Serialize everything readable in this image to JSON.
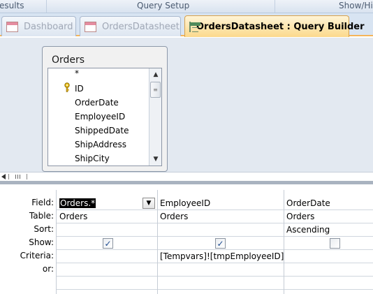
{
  "ribbon": {
    "groups": [
      "esults",
      "Query Setup",
      "Show/Hi"
    ]
  },
  "tabs": [
    {
      "label": "Dashboard",
      "icon": "form-icon",
      "active": false
    },
    {
      "label": "OrdersDatasheet",
      "icon": "form-icon",
      "active": false
    },
    {
      "label": "OrdersDatasheet : Query Builder",
      "icon": "query-icon",
      "active": true
    }
  ],
  "table_box": {
    "title": "Orders",
    "fields": [
      "*",
      "ID",
      "OrderDate",
      "EmployeeID",
      "ShippedDate",
      "ShipAddress",
      "ShipCity"
    ],
    "key_field": "ID"
  },
  "grid": {
    "row_labels": [
      "Field:",
      "Table:",
      "Sort:",
      "Show:",
      "Criteria:",
      "or:"
    ],
    "columns": [
      {
        "field": "Orders.*",
        "table": "Orders",
        "sort": "",
        "show": true,
        "criteria": ""
      },
      {
        "field": "EmployeeID",
        "table": "Orders",
        "sort": "",
        "show": true,
        "criteria": "[Tempvars]![tmpEmployeeID]"
      },
      {
        "field": "OrderDate",
        "table": "Orders",
        "sort": "Ascending",
        "show": false,
        "criteria": ""
      }
    ]
  },
  "colors": {
    "active_tab": "#fbd98c",
    "upper_pane": "#e3e9f1",
    "checkmark": "#1c4a90"
  }
}
